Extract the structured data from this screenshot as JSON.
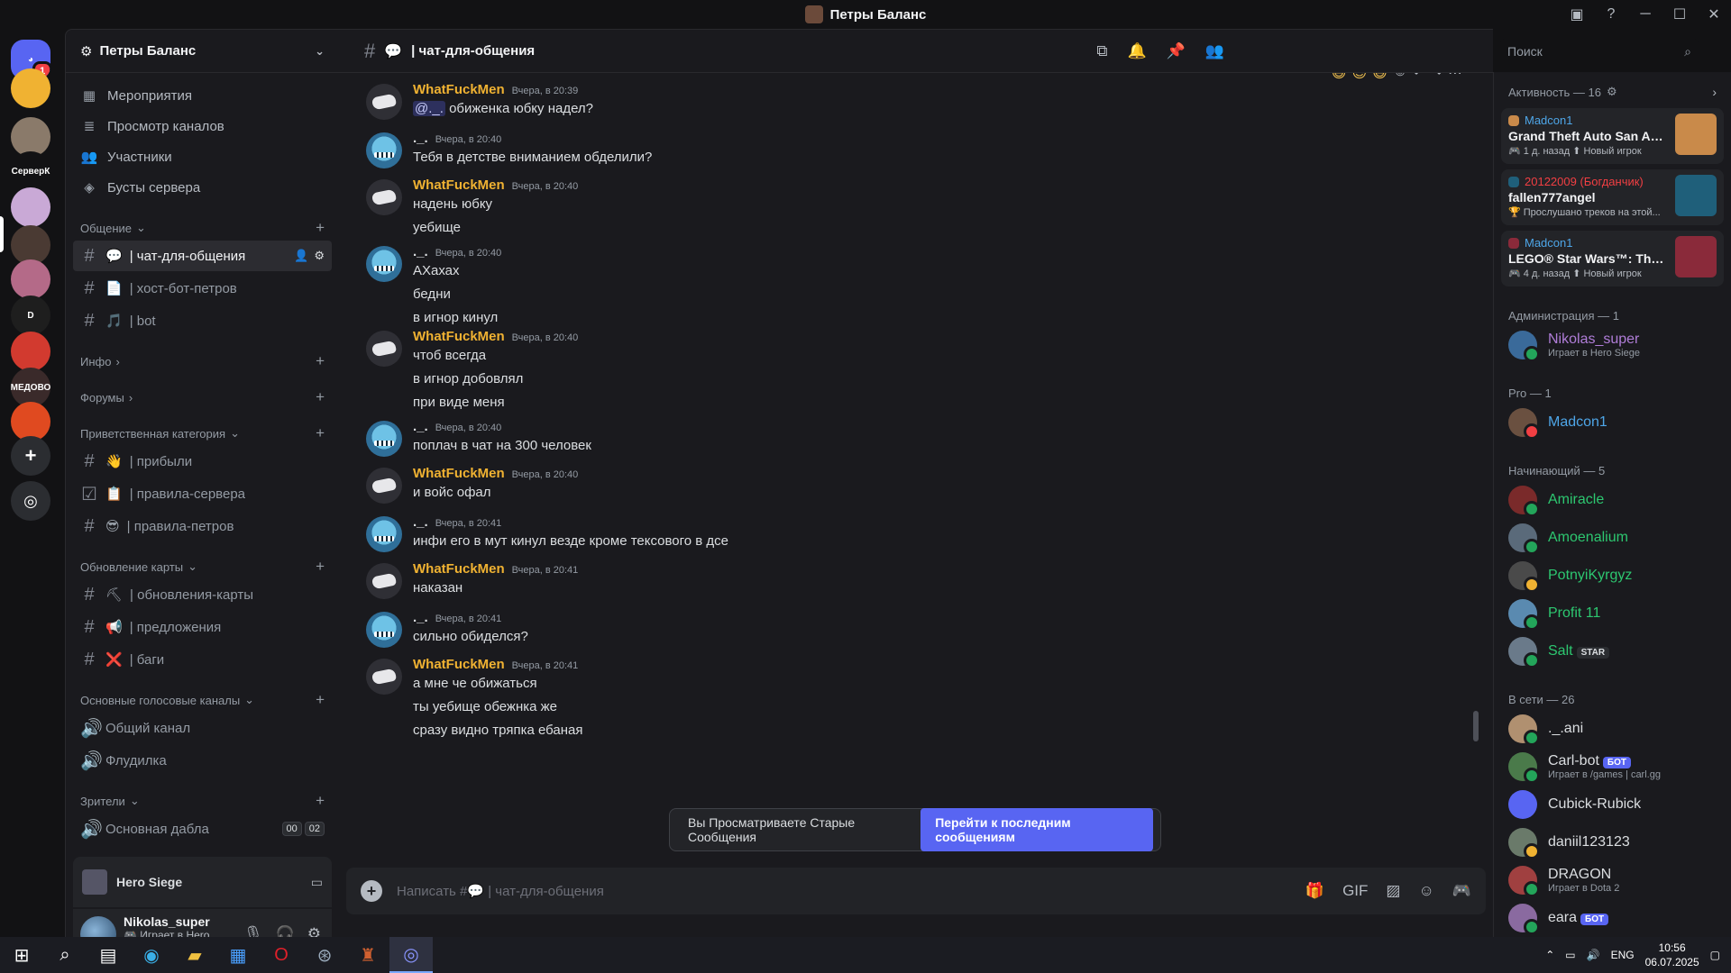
{
  "window": {
    "title": "Петры Баланс"
  },
  "servers": [
    {
      "label": "",
      "color": "#5865f2",
      "type": "home",
      "badge": "1"
    },
    {
      "label": "",
      "color": "#f0b232"
    },
    {
      "label": "",
      "color": "#8a7a6a"
    },
    {
      "label": "СерверК",
      "color": "#121214"
    },
    {
      "label": "",
      "color": "#c9a9d6"
    },
    {
      "label": "",
      "color": "#4a3a33"
    },
    {
      "label": "",
      "color": "#b46a88"
    },
    {
      "label": "D",
      "color": "#1e1e1e"
    },
    {
      "label": "",
      "color": "#d23a2f"
    },
    {
      "label": "МЕДОВО",
      "color": "#3a2a2a"
    },
    {
      "label": "",
      "color": "#e04a20"
    }
  ],
  "sidebar": {
    "guild_name": "Петры Баланс",
    "nav": [
      {
        "icon": "calendar-icon",
        "glyph": "▦",
        "label": "Мероприятия"
      },
      {
        "icon": "browse-channels-icon",
        "glyph": "≣",
        "label": "Просмотр каналов"
      },
      {
        "icon": "members-icon",
        "glyph": "👥",
        "label": "Участники"
      },
      {
        "icon": "boost-icon",
        "glyph": "◈",
        "label": "Бусты сервера"
      }
    ],
    "categories": [
      {
        "name": "Общение",
        "chev": "⌄",
        "channels": [
          {
            "emoji": "💬",
            "name": "| чат-для-общения",
            "active": true
          },
          {
            "emoji": "📄",
            "name": "| хост-бот-петров"
          },
          {
            "emoji": "🎵",
            "name": "| bot"
          }
        ]
      },
      {
        "name": "Инфо",
        "chev": "›",
        "channels": []
      },
      {
        "name": "Форумы",
        "chev": "›",
        "channels": []
      },
      {
        "name": "Приветственная категория",
        "chev": "⌄",
        "channels": [
          {
            "emoji": "👋",
            "name": "| прибыли"
          },
          {
            "emoji": "📋",
            "name": "| правила-сервера",
            "rules": true
          },
          {
            "emoji": "😎",
            "name": "| правила-петров"
          }
        ]
      },
      {
        "name": "Обновление карты",
        "chev": "⌄",
        "channels": [
          {
            "emoji": "⛏",
            "name": "| обновления-карты"
          },
          {
            "emoji": "📢",
            "name": "| предложения"
          },
          {
            "emoji": "❌",
            "name": "| баги"
          }
        ]
      },
      {
        "name": "Основные голосовые каналы",
        "chev": "⌄",
        "channels": [
          {
            "voice": true,
            "name": "Общий канал"
          },
          {
            "voice": true,
            "name": "Флудилка"
          }
        ]
      },
      {
        "name": "Зрители",
        "chev": "⌄",
        "channels": [
          {
            "voice": true,
            "name": "Основная дабла",
            "counts": [
              "00",
              "02"
            ]
          }
        ]
      }
    ],
    "activity_game": "Hero Siege",
    "user": {
      "name": "Nikolas_super",
      "status": "Играет в Hero Siege"
    }
  },
  "chat": {
    "channel_name": "| чат-для-общения",
    "search_placeholder": "Поиск",
    "messages": [
      {
        "author": "WhatFuckMen",
        "av": "wfm",
        "time": "Вчера, в 20:39",
        "lines": [
          "обиженка юбку надел?"
        ],
        "mention": "@._."
      },
      {
        "author": "._.",
        "av": "shark",
        "time": "Вчера, в 20:40",
        "lines": [
          "Тебя в детстве вниманием обделили?"
        ]
      },
      {
        "author": "WhatFuckMen",
        "av": "wfm",
        "time": "Вчера, в 20:40",
        "lines": [
          "надень юбку",
          "уебище"
        ]
      },
      {
        "author": "._.",
        "av": "shark",
        "time": "Вчера, в 20:40",
        "lines": [
          "АХахах",
          "бедни",
          "в игнор кинул"
        ]
      },
      {
        "author": "WhatFuckMen",
        "av": "wfm",
        "time": "Вчера, в 20:40",
        "lines": [
          "чтоб всегда",
          "в игнор добовлял",
          "при виде меня"
        ]
      },
      {
        "author": "._.",
        "av": "shark",
        "time": "Вчера, в 20:40",
        "lines": [
          "поплач в чат на 300 человек"
        ]
      },
      {
        "author": "WhatFuckMen",
        "av": "wfm",
        "time": "Вчера, в 20:40",
        "lines": [
          "и войс офал"
        ]
      },
      {
        "author": "._.",
        "av": "shark",
        "time": "Вчера, в 20:41",
        "lines": [
          "инфи его в мут кинул везде кроме тексового в дсе"
        ]
      },
      {
        "author": "WhatFuckMen",
        "av": "wfm",
        "time": "Вчера, в 20:41",
        "lines": [
          "наказан"
        ]
      },
      {
        "author": "._.",
        "av": "shark",
        "time": "Вчера, в 20:41",
        "lines": [
          "сильно обиделся?"
        ]
      },
      {
        "author": "WhatFuckMen",
        "av": "wfm",
        "time": "Вчера, в 20:41",
        "lines": [
          "а мне че обижаться",
          "ты уебище обежнка же",
          "сразу видно тряпка ебаная"
        ]
      }
    ],
    "jump_text": "Вы Просматриваете Старые Сообщения",
    "jump_button": "Перейти к последним сообщениям",
    "composer_placeholder": "Написать #💬 | чат-для-общения"
  },
  "members": {
    "activity_header": "Активность — 16",
    "activity_cards": [
      {
        "user": "Madcon1",
        "user_color": "#4ea6e8",
        "game": "Grand Theft Auto San Andr...",
        "meta": "1 д. назад",
        "tag": "Новый игрок",
        "art": "#c98a4a"
      },
      {
        "user": "20122009 (Богданчик)",
        "user_color": "#f23f43",
        "game": "fallen777angel",
        "meta": "Прослушано треков на этой...",
        "tag": "",
        "art": "#1f5f7a"
      },
      {
        "user": "Madcon1",
        "user_color": "#4ea6e8",
        "game": "LEGO® Star Wars™: The Sk...",
        "meta": "4 д. назад",
        "tag": "Новый игрок",
        "art": "#8a2a3a"
      }
    ],
    "groups": [
      {
        "title": "Администрация — 1",
        "users": [
          {
            "name": "Nikolas_super",
            "color": "#b07dd8",
            "sub": "Играет в Hero Siege",
            "status": "#23a55a",
            "av": "#3a6a9a"
          }
        ]
      },
      {
        "title": "Pro — 1",
        "users": [
          {
            "name": "Madcon1",
            "color": "#4ea6e8",
            "status": "#f23f43",
            "av": "#6a5040"
          }
        ]
      },
      {
        "title": "Начинающий — 5",
        "users": [
          {
            "name": "Amiracle",
            "color": "#2dc770",
            "status": "#23a55a",
            "av": "#7a2a2a"
          },
          {
            "name": "Amoenalium",
            "color": "#2dc770",
            "status": "#23a55a",
            "av": "#5a6a7a"
          },
          {
            "name": "PotnyiKyrgyz",
            "color": "#2dc770",
            "status": "#f0b232",
            "av": "#4a4a4a"
          },
          {
            "name": "Profit 11",
            "color": "#2dc770",
            "status": "#23a55a",
            "av": "#5a8ab0"
          },
          {
            "name": "Salt",
            "color": "#2dc770",
            "status": "#23a55a",
            "av": "#6a7a8a",
            "tag": "STAR",
            "tag_type": "star"
          }
        ]
      },
      {
        "title": "В сети — 26",
        "users": [
          {
            "name": "._.ani",
            "color": "#dbdee1",
            "status": "#23a55a",
            "av": "#b09070"
          },
          {
            "name": "Carl-bot",
            "color": "#dbdee1",
            "sub": "Играет в /games | carl.gg",
            "status": "#23a55a",
            "av": "#4a7a4a",
            "tag": "БОТ",
            "tag_type": "bot"
          },
          {
            "name": "Cubick-Rubick",
            "color": "#dbdee1",
            "status": "",
            "av": "#5865f2"
          },
          {
            "name": "daniil123123",
            "color": "#dbdee1",
            "status": "#f0b232",
            "av": "#6a7a6a"
          },
          {
            "name": "DRAGON",
            "color": "#dbdee1",
            "sub": "Играет в Dota 2",
            "status": "#23a55a",
            "av": "#a04040"
          },
          {
            "name": "eara",
            "color": "#dbdee1",
            "status": "#23a55a",
            "av": "#8a6aa0",
            "tag": "БОТ",
            "tag_type": "bot"
          }
        ]
      }
    ]
  },
  "taskbar": {
    "lang": "ENG",
    "time": "10:56",
    "date": "06.07.2025"
  }
}
